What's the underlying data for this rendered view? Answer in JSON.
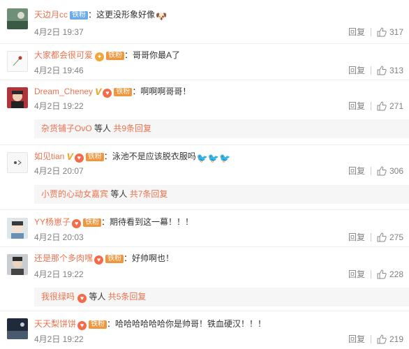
{
  "reply_label": "回复",
  "comments": [
    {
      "username": "天边月cc",
      "fan_badge": "铁粉",
      "text": "：这更没形象好像",
      "emoji": "🐶",
      "time": "4月2日 19:37",
      "likes": "317"
    },
    {
      "username": "大家都会很可爱",
      "fan_badge": "铁粉",
      "text": "：哥哥你最A了",
      "time": "4月2日 19:46",
      "likes": "313"
    },
    {
      "username": "Dream_Cheney",
      "fan_badge": "铁粉",
      "verified": "V",
      "text": "：啊啊啊哥哥！",
      "time": "4月2日 19:22",
      "likes": "271",
      "subreplies": {
        "user": "杂货铺子OvO",
        "mid": " 等人 ",
        "more": "共9条回复"
      }
    },
    {
      "username": "如见tian",
      "fan_badge": "铁粉",
      "verified": "V",
      "text": "：泳池不是应该脱衣服吗",
      "emoji": "🐦🐦🐦",
      "time": "4月2日 20:07",
      "likes": "306",
      "subreplies": {
        "user": "小贾的心动女嘉宾",
        "mid": " 等人 ",
        "more": "共7条回复"
      }
    },
    {
      "username": "YY杨崽子",
      "fan_badge": "铁粉",
      "text": "：期待看到这一幕！！！",
      "time": "4月2日 20:03",
      "likes": "275"
    },
    {
      "username": "还是那个多肉嘿",
      "fan_badge": "铁粉",
      "text": "：好帅啊也！",
      "time": "4月2日 19:22",
      "likes": "228",
      "subreplies": {
        "user": "我很绿吗",
        "mid": " 等人 ",
        "more": "共5条回复"
      }
    },
    {
      "username": "天天梨饼饼",
      "fan_badge": "铁粉",
      "text": "：哈哈哈哈哈哈你是帅哥！铁血硬汉！！！",
      "time": "4月2日 19:22",
      "likes": "219"
    }
  ],
  "colors": {
    "username": "#eb7350",
    "meta": "#808080",
    "subreply_bg": "#f6f6f6",
    "fan_blue": "#6cabe8",
    "fan_orange": "#f0963c"
  },
  "icons": [
    "like-thumb-icon",
    "fan-medal-icon",
    "vip-icon",
    "verified-v-icon"
  ]
}
